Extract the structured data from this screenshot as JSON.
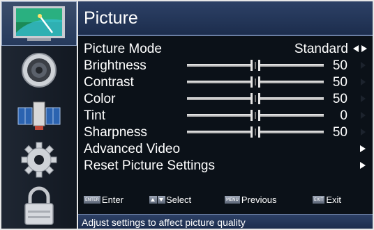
{
  "panel": {
    "title": "Picture",
    "items": [
      {
        "label": "Picture Mode",
        "value": "Standard"
      },
      {
        "label": "Brightness",
        "value": "50",
        "level": 50
      },
      {
        "label": "Contrast",
        "value": "50",
        "level": 50
      },
      {
        "label": "Color",
        "value": "50",
        "level": 50
      },
      {
        "label": "Tint",
        "value": "0",
        "level": 0
      },
      {
        "label": "Sharpness",
        "value": "50",
        "level": 50
      },
      {
        "label": "Advanced Video"
      },
      {
        "label": "Reset Picture Settings"
      }
    ]
  },
  "hints": {
    "enter": {
      "key": "ENTER",
      "label": "Enter"
    },
    "select": {
      "label": "Select"
    },
    "previous": {
      "key": "MENU",
      "label": "Previous"
    },
    "exit": {
      "key": "EXIT",
      "label": "Exit"
    }
  },
  "status": {
    "text": "Adjust settings to affect picture quality"
  },
  "sidebar": {
    "icons": [
      "picture-icon",
      "audio-speaker-icon",
      "network-satellite-icon",
      "settings-gear-icon",
      "parental-lock-icon"
    ]
  },
  "colors": {
    "title_bar": "#2d4166",
    "panel_bg": "#0b1118",
    "sidebar_bg": "#1f2733",
    "text": "#ffffff"
  }
}
